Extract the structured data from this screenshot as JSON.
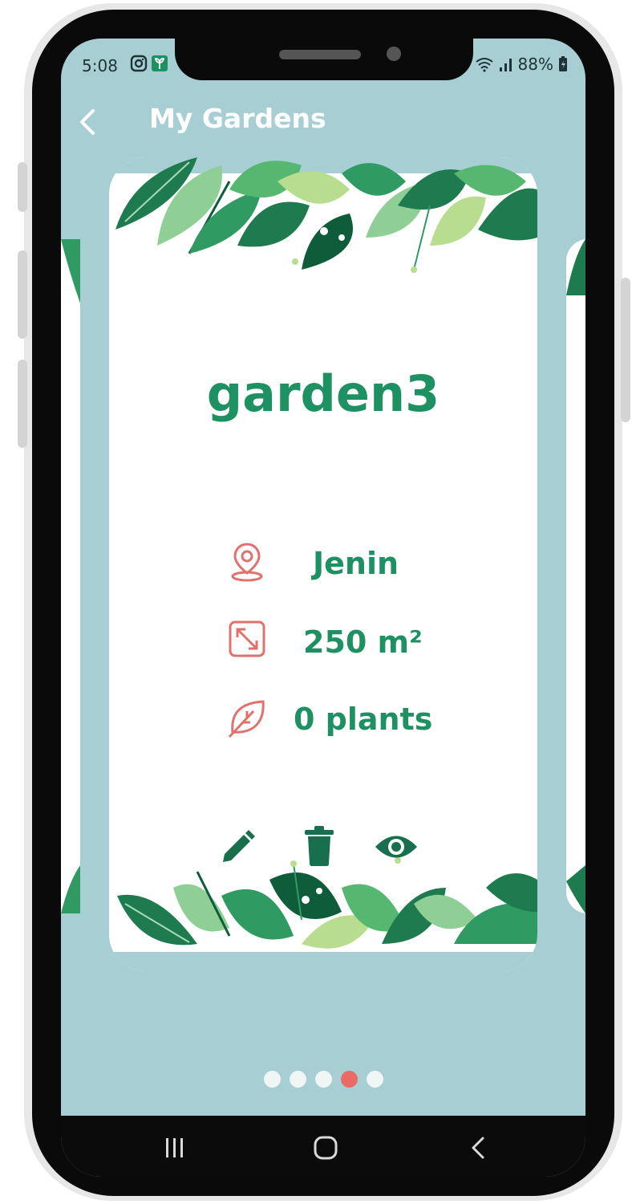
{
  "status_bar": {
    "time": "5:08",
    "battery": "88%"
  },
  "header": {
    "title": "My Gardens"
  },
  "garden": {
    "name": "garden3",
    "location": "Jenin",
    "area": "250 m²",
    "plants": "0 plants"
  },
  "pager": {
    "total": 5,
    "active_index": 3
  },
  "colors": {
    "background": "#a7cfd3",
    "accent_green": "#1e9163",
    "dark_green": "#176f4e",
    "icon_red": "#e0716c",
    "active_dot": "#ea6a66"
  }
}
